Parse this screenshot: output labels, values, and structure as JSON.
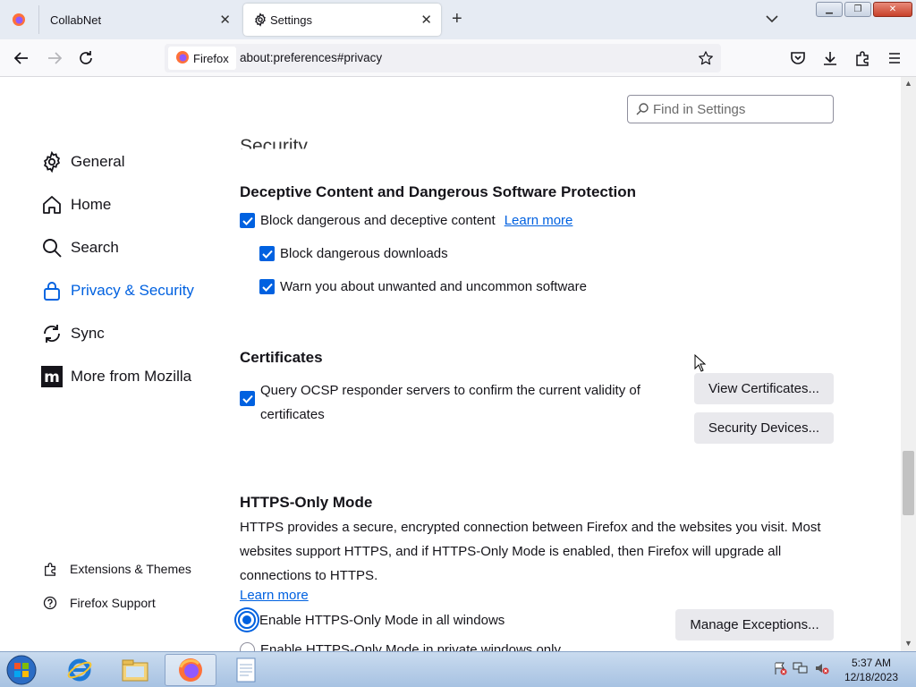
{
  "tabs": [
    {
      "title": "CollabNet",
      "icon": "firefox-icon",
      "active": false
    },
    {
      "title": "Settings",
      "icon": "gear-icon",
      "active": true
    }
  ],
  "nav": {
    "identity_label": "Firefox",
    "url": "about:preferences#privacy"
  },
  "search": {
    "placeholder": "Find in Settings"
  },
  "sidebar": {
    "items": [
      {
        "label": "General",
        "icon": "gear-icon"
      },
      {
        "label": "Home",
        "icon": "home-icon"
      },
      {
        "label": "Search",
        "icon": "search-icon"
      },
      {
        "label": "Privacy & Security",
        "icon": "lock-icon",
        "selected": true
      },
      {
        "label": "Sync",
        "icon": "sync-icon"
      },
      {
        "label": "More from Mozilla",
        "icon": "mozilla-icon"
      }
    ],
    "footer": [
      {
        "label": "Extensions & Themes",
        "icon": "puzzle-icon"
      },
      {
        "label": "Firefox Support",
        "icon": "help-icon"
      }
    ]
  },
  "main": {
    "partial_heading": "Security",
    "deceptive": {
      "heading": "Deceptive Content and Dangerous Software Protection",
      "block_label": "Block dangerous and deceptive content",
      "learn_more": "Learn more",
      "downloads_label": "Block dangerous downloads",
      "warn_label": "Warn you about unwanted and uncommon software"
    },
    "certificates": {
      "heading": "Certificates",
      "ocsp_line1": "Query OCSP responder servers to confirm the current validity of",
      "ocsp_line2": "certificates",
      "view_button": "View Certificates...",
      "devices_button": "Security Devices..."
    },
    "https": {
      "heading": "HTTPS-Only Mode",
      "description_line1": "HTTPS provides a secure, encrypted connection between Firefox and the websites you visit. Most",
      "description_line2": "websites support HTTPS, and if HTTPS-Only Mode is enabled, then Firefox will upgrade all",
      "description_line3": "connections to HTTPS.",
      "learn_more": "Learn more",
      "option_all": "Enable HTTPS-Only Mode in all windows",
      "option_private": "Enable HTTPS-Only Mode in private windows only",
      "manage_button": "Manage Exceptions..."
    }
  },
  "taskbar": {
    "time": "5:37 AM",
    "date": "12/18/2023"
  },
  "colors": {
    "accent": "#0061e0",
    "tabbar_bg": "#e6ebf3",
    "taskbar_bg": "#b5cbe6"
  }
}
